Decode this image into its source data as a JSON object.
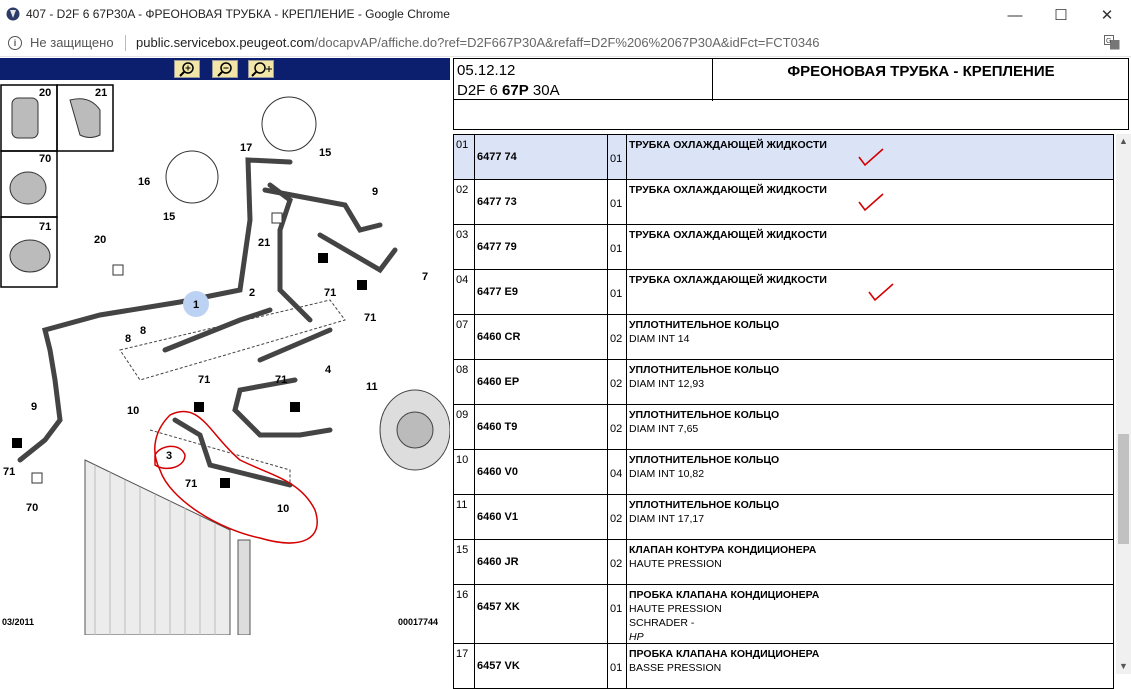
{
  "window": {
    "title": "407 - D2F 6 67P30A - ФРЕОНОВАЯ ТРУБКА - КРЕПЛЕНИЕ - Google Chrome",
    "minimize": "—",
    "maximize": "☐",
    "close": "✕"
  },
  "address": {
    "security": "Не защищено",
    "host": "public.servicebox.peugeot.com",
    "path": "/docapvAP/affiche.do?ref=D2F667P30A&refaff=D2F%206%2067P30A&idFct=FCT0346"
  },
  "diagram": {
    "zoom_buttons": [
      "zoom-in-icon",
      "zoom-out-icon",
      "zoom-fit-icon"
    ],
    "labels": [
      "20",
      "21",
      "70",
      "71",
      "17",
      "15",
      "16",
      "15",
      "9",
      "7",
      "20",
      "21",
      "2",
      "1",
      "71",
      "8",
      "8",
      "71",
      "4",
      "71",
      "71",
      "11",
      "9",
      "10",
      "3",
      "71",
      "10",
      "71",
      "70"
    ],
    "date": "03/2011",
    "code": "00017744"
  },
  "header": {
    "date": "05.12.12",
    "ref_prefix": "D2F 6 ",
    "ref_bold": "67P",
    "ref_suffix": " 30A",
    "title": "ФРЕОНОВАЯ ТРУБКА - КРЕПЛЕНИЕ"
  },
  "parts": [
    {
      "idx": "01",
      "ref": "6477 74",
      "qty": "01",
      "desc": "ТРУБКА ОХЛАЖДАЮЩЕЙ ЖИДКОСТИ",
      "sub": "",
      "sub2": "",
      "sub3": "",
      "selected": true,
      "check": true
    },
    {
      "idx": "02",
      "ref": "6477 73",
      "qty": "01",
      "desc": "ТРУБКА ОХЛАЖДАЮЩЕЙ ЖИДКОСТИ",
      "sub": "",
      "sub2": "",
      "sub3": "",
      "check": true
    },
    {
      "idx": "03",
      "ref": "6477 79",
      "qty": "01",
      "desc": "ТРУБКА ОХЛАЖДАЮЩЕЙ ЖИДКОСТИ",
      "sub": "",
      "sub2": "",
      "sub3": "",
      "circled": true
    },
    {
      "idx": "04",
      "ref": "6477 E9",
      "qty": "01",
      "desc": "ТРУБКА ОХЛАЖДАЮЩЕЙ ЖИДКОСТИ",
      "sub": "",
      "sub2": "",
      "sub3": "",
      "check": true
    },
    {
      "idx": "07",
      "ref": "6460 CR",
      "qty": "02",
      "desc": "УПЛОТНИТЕЛЬНОЕ КОЛЬЦО",
      "sub": "DIAM INT 14",
      "sub2": "",
      "sub3": ""
    },
    {
      "idx": "08",
      "ref": "6460 EP",
      "qty": "02",
      "desc": "УПЛОТНИТЕЛЬНОЕ КОЛЬЦО",
      "sub": "DIAM INT 12,93",
      "sub2": "",
      "sub3": ""
    },
    {
      "idx": "09",
      "ref": "6460 T9",
      "qty": "02",
      "desc": "УПЛОТНИТЕЛЬНОЕ КОЛЬЦО",
      "sub": "DIAM INT 7,65",
      "sub2": "",
      "sub3": ""
    },
    {
      "idx": "10",
      "ref": "6460 V0",
      "qty": "04",
      "desc": "УПЛОТНИТЕЛЬНОЕ КОЛЬЦО",
      "sub": "DIAM INT 10,82",
      "sub2": "",
      "sub3": ""
    },
    {
      "idx": "11",
      "ref": "6460 V1",
      "qty": "02",
      "desc": "УПЛОТНИТЕЛЬНОЕ КОЛЬЦО",
      "sub": "DIAM INT 17,17",
      "sub2": "",
      "sub3": ""
    },
    {
      "idx": "15",
      "ref": "6460 JR",
      "qty": "02",
      "desc": "КЛАПАН КОНТУРА КОНДИЦИОНЕРА",
      "sub": "HAUTE PRESSION",
      "sub2": "",
      "sub3": ""
    },
    {
      "idx": "16",
      "ref": "6457 XK",
      "qty": "01",
      "desc": "ПРОБКА КЛАПАНА КОНДИЦИОНЕРА",
      "sub": "HAUTE PRESSION",
      "sub2": "SCHRADER -",
      "sub3": "HP"
    },
    {
      "idx": "17",
      "ref": "6457 VK",
      "qty": "01",
      "desc": "ПРОБКА КЛАПАНА КОНДИЦИОНЕРА",
      "sub": "BASSE PRESSION",
      "sub2": "",
      "sub3": ""
    }
  ],
  "colors": {
    "toolbar": "#0b1f6e",
    "selected_row": "#dbe3f7",
    "annotation": "#d40000"
  }
}
